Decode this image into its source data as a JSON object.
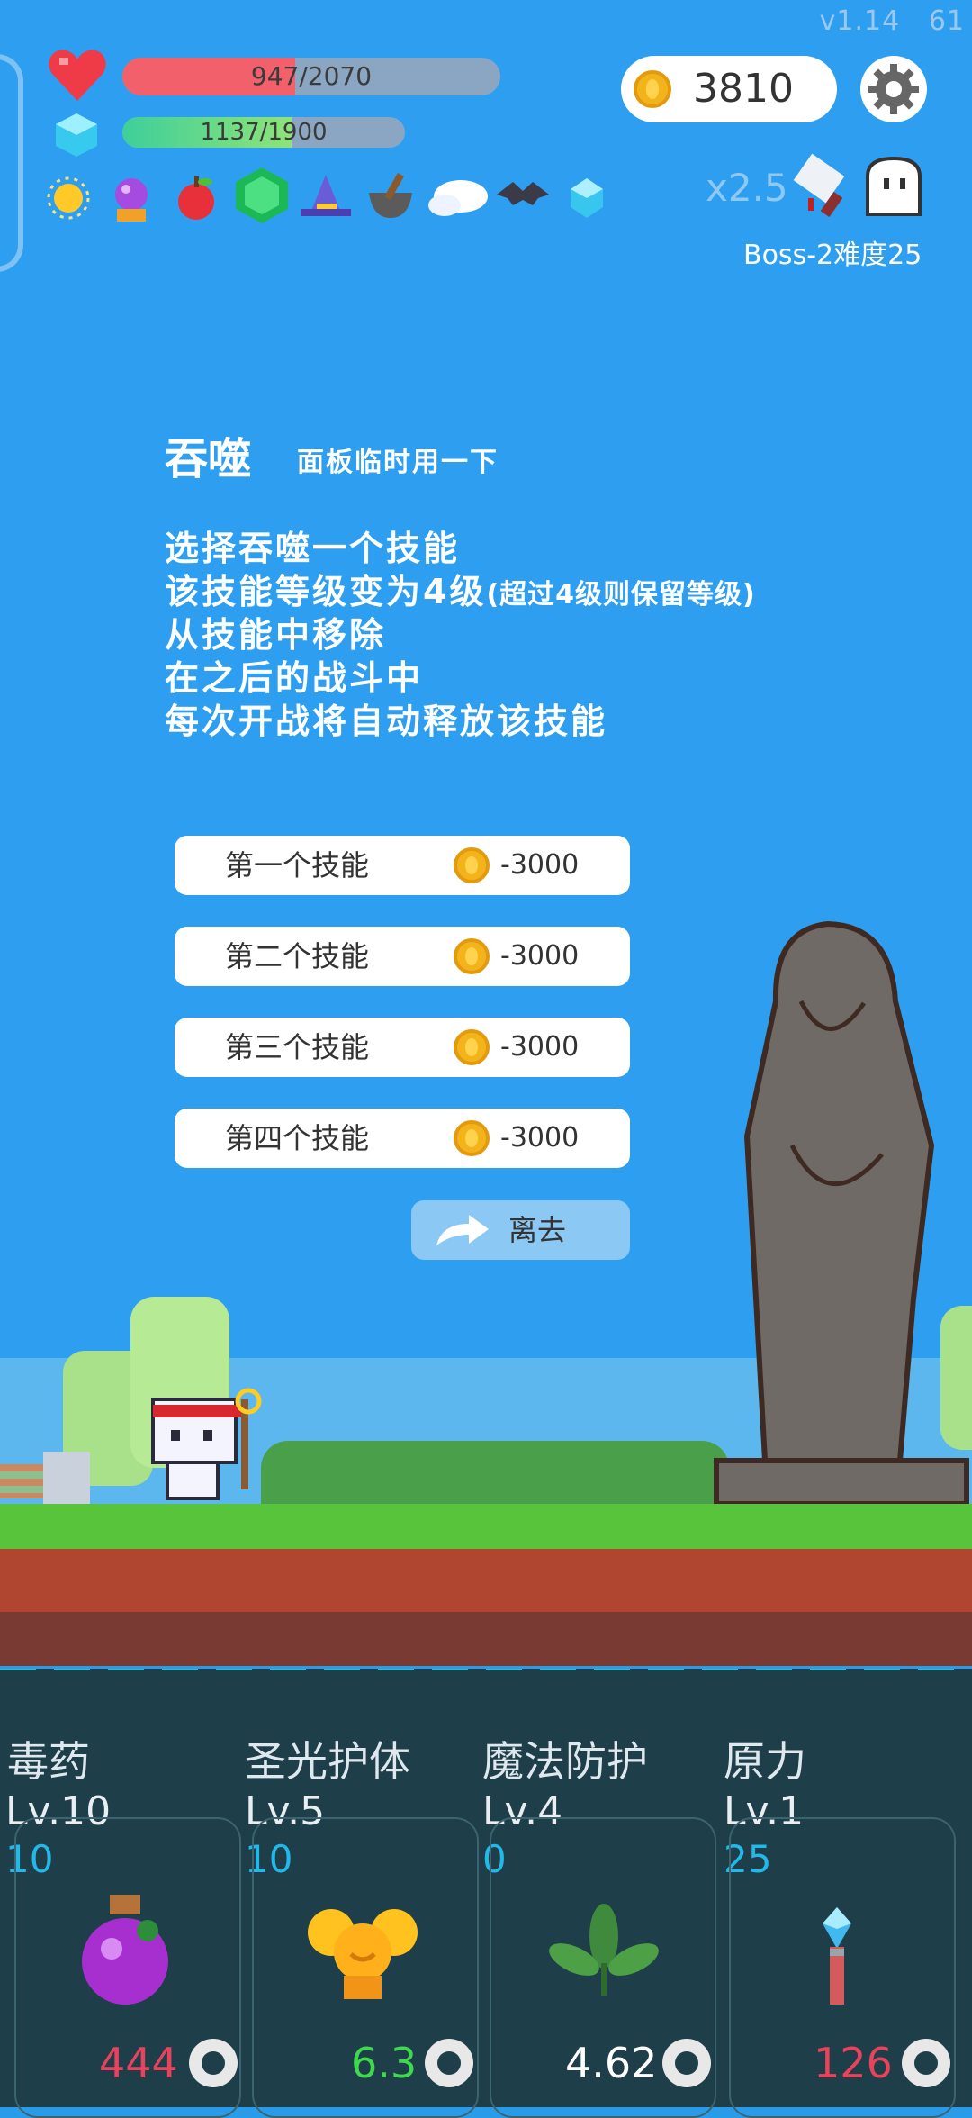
{
  "version": "v1.14",
  "fps": "61",
  "hp": {
    "text": "947/2070",
    "fraction": 0.457,
    "color": "#f2606b"
  },
  "mp": {
    "text": "1137/1900",
    "fraction": 0.598,
    "color": "#3ecf9a"
  },
  "coins": "3810",
  "multiplier": "x2.5",
  "boss_label": "Boss-2难度25",
  "items": [
    "sun-orb",
    "crystal-ball",
    "apple",
    "emerald",
    "witch-hat",
    "mortar",
    "wings",
    "bat",
    "ice-crystal"
  ],
  "panel": {
    "title": "吞噬",
    "subtitle": "面板临时用一下",
    "lines": [
      "选择吞噬一个技能",
      "该技能等级变为4级",
      "(超过4级则保留等级)",
      "从技能中移除",
      "在之后的战斗中",
      "每次开战将自动释放该技能"
    ]
  },
  "options": [
    {
      "label": "第一个技能",
      "price": "-3000"
    },
    {
      "label": "第二个技能",
      "price": "-3000"
    },
    {
      "label": "第三个技能",
      "price": "-3000"
    },
    {
      "label": "第四个技能",
      "price": "-3000"
    }
  ],
  "leave_label": "离去",
  "skills": [
    {
      "name": "毒药",
      "level": "Lv.10",
      "cost": "10",
      "value": "444",
      "value_color": "#e8435d",
      "icon": "potion-icon"
    },
    {
      "name": "圣光护体",
      "level": "Lv.5",
      "cost": "10",
      "value": "6.3",
      "value_color": "#3fd94f",
      "icon": "holy-light-icon"
    },
    {
      "name": "魔法防护",
      "level": "Lv.4",
      "cost": "0",
      "value": "4.62",
      "value_color": "#ffffff",
      "icon": "leaf-icon"
    },
    {
      "name": "原力",
      "level": "Lv.1",
      "cost": "25",
      "value": "126",
      "value_color": "#e8435d",
      "icon": "crystal-wand-icon"
    }
  ]
}
